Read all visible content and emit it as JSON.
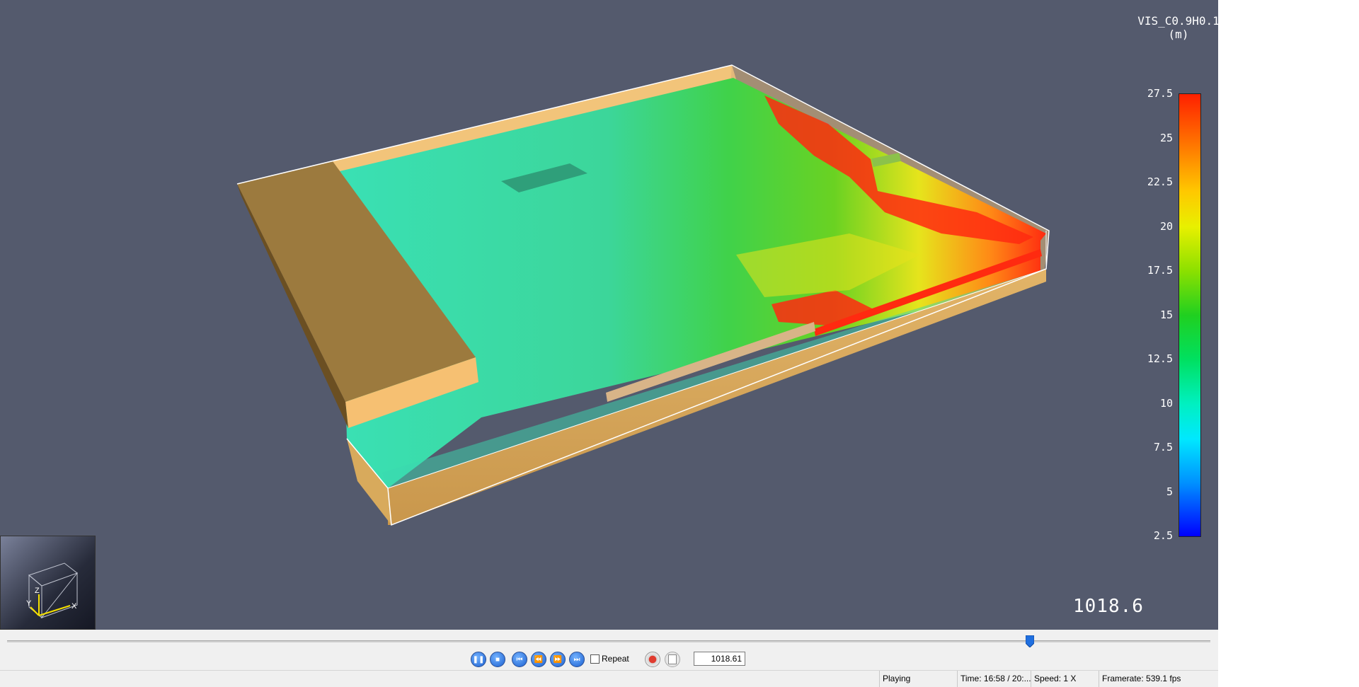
{
  "colorbar": {
    "title_line1": "VIS_C0.9H0.1",
    "title_line2": "(m)",
    "ticks": [
      "27.5",
      "25",
      "22.5",
      "20",
      "17.5",
      "15",
      "12.5",
      "10",
      "7.5",
      "5",
      "2.5"
    ]
  },
  "axes": {
    "z": "Z",
    "y": "Y",
    "x": "X"
  },
  "overlay": {
    "time_readout": "1018.6"
  },
  "playback": {
    "slider_position": 0.85,
    "buttons": [
      "pause",
      "stop",
      "first",
      "step-back",
      "step-forward",
      "last"
    ],
    "repeat_label": "Repeat",
    "repeat_checked": false,
    "time_value": "1018.61"
  },
  "status": {
    "state": "Playing",
    "time": "Time: 16:58 / 20:...",
    "speed": "Speed: 1 X",
    "framerate": "Framerate: 539.1 fps"
  },
  "colors": {
    "viewport_bg": "#545a6d",
    "wall": "#e8b060",
    "floor_field_cool": "#36d7a8",
    "floor_field_mid": "#36d13a",
    "floor_field_hot": "#ff2a10"
  }
}
